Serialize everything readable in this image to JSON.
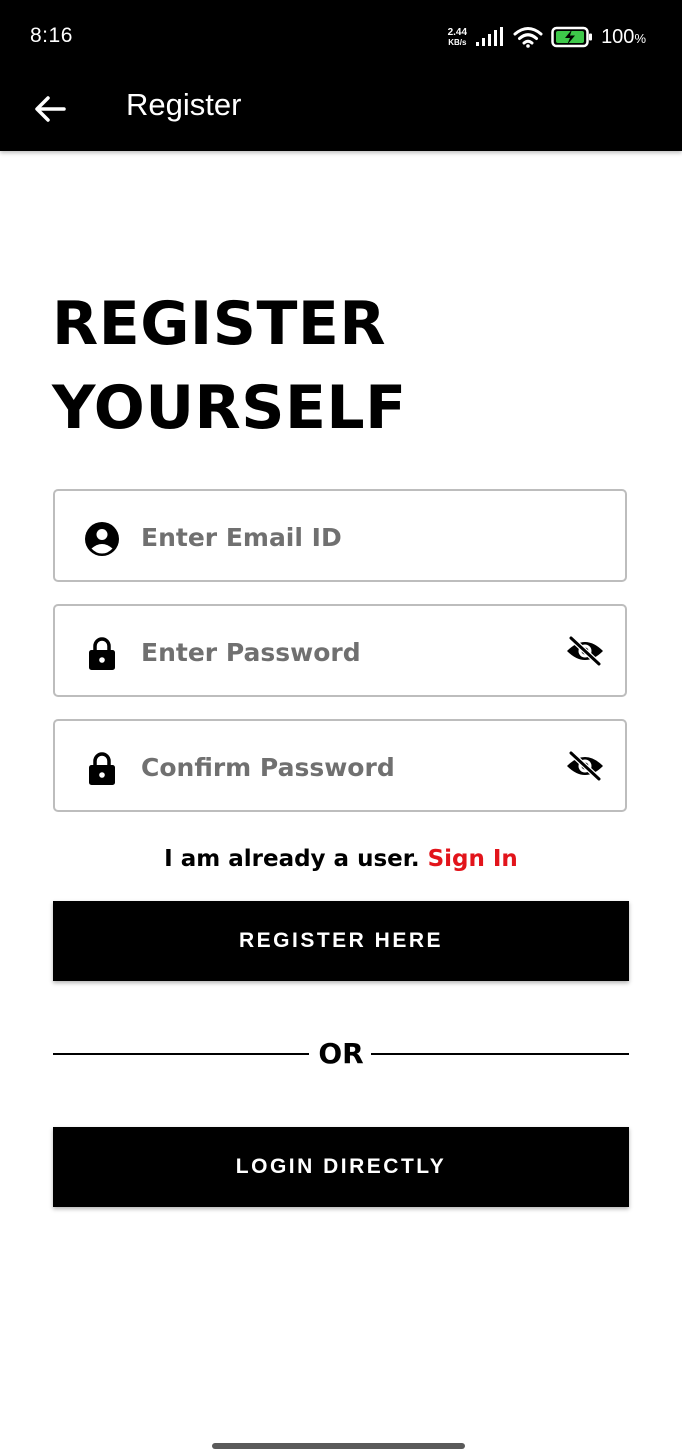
{
  "status_bar": {
    "time": "8:16",
    "net_speed_value": "2.44",
    "net_speed_unit": "KB/s",
    "battery_percent": "100",
    "battery_percent_sign": "%"
  },
  "app_bar": {
    "title": "Register",
    "back_icon": "arrow-left-icon"
  },
  "heading": {
    "line1": "REGISTER",
    "line2": "YOURSELF"
  },
  "form": {
    "email": {
      "placeholder": "Enter Email ID",
      "value": "",
      "icon": "account-circle-icon"
    },
    "password": {
      "placeholder": "Enter Password",
      "value": "",
      "icon": "lock-icon",
      "toggle_icon": "eye-off-icon"
    },
    "confirm_password": {
      "placeholder": "Confirm Password",
      "value": "",
      "icon": "lock-icon",
      "toggle_icon": "eye-off-icon"
    }
  },
  "signin_prompt": {
    "text": "I am already a user.",
    "link": "Sign In"
  },
  "buttons": {
    "register": "REGISTER HERE",
    "or": "OR",
    "login": "LOGIN DIRECTLY"
  },
  "colors": {
    "primary": "#000000",
    "accent_link": "#e2141b",
    "background": "#ffffff",
    "field_border": "#bdbdbd",
    "placeholder": "#707070"
  }
}
